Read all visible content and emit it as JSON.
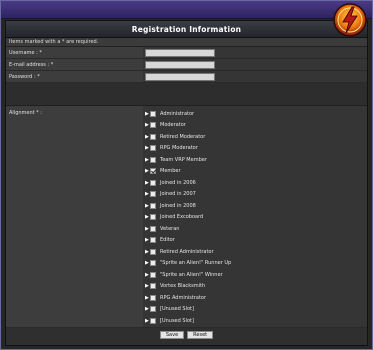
{
  "header": {
    "title": "Registration Information"
  },
  "form": {
    "note": "Items marked with a * are required.",
    "fields": [
      {
        "label": "Username : *",
        "value": ""
      },
      {
        "label": "E-mail address : *",
        "value": ""
      },
      {
        "label": "Password : *",
        "value": ""
      }
    ],
    "alignment_label": "Alignment * :",
    "alignment_options": [
      {
        "label": "Administrator",
        "checked": false
      },
      {
        "label": "Moderator",
        "checked": false
      },
      {
        "label": "Retired Moderator",
        "checked": false
      },
      {
        "label": "RPG Moderator",
        "checked": false
      },
      {
        "label": "Team VRP Member",
        "checked": false
      },
      {
        "label": "Member",
        "checked": true
      },
      {
        "label": "Joined in 2006",
        "checked": false
      },
      {
        "label": "Joined in 2007",
        "checked": false
      },
      {
        "label": "Joined in 2008",
        "checked": false
      },
      {
        "label": "Joined Excoboard",
        "checked": false
      },
      {
        "label": "Veteran",
        "checked": false
      },
      {
        "label": "Editor",
        "checked": false
      },
      {
        "label": "Retired Administrator",
        "checked": false
      },
      {
        "label": "\"Sprite an Alien!\" Runner Up",
        "checked": false
      },
      {
        "label": "\"Sprite an Alien!\" Winner",
        "checked": false
      },
      {
        "label": "Vortex Blacksmith",
        "checked": false
      },
      {
        "label": "RPG Administrator",
        "checked": false
      },
      {
        "label": "[Unused Slot]",
        "checked": false
      },
      {
        "label": "[Unused Slot]",
        "checked": false
      }
    ],
    "save_label": "Save",
    "reset_label": "Reset"
  },
  "colors": {
    "top_band": "#3a2f72",
    "logo_orange": "#f07a10",
    "logo_red": "#b51818"
  },
  "icons": {
    "logo": "lightning-bolt-icon",
    "option_marker": "triangle-right-icon"
  }
}
